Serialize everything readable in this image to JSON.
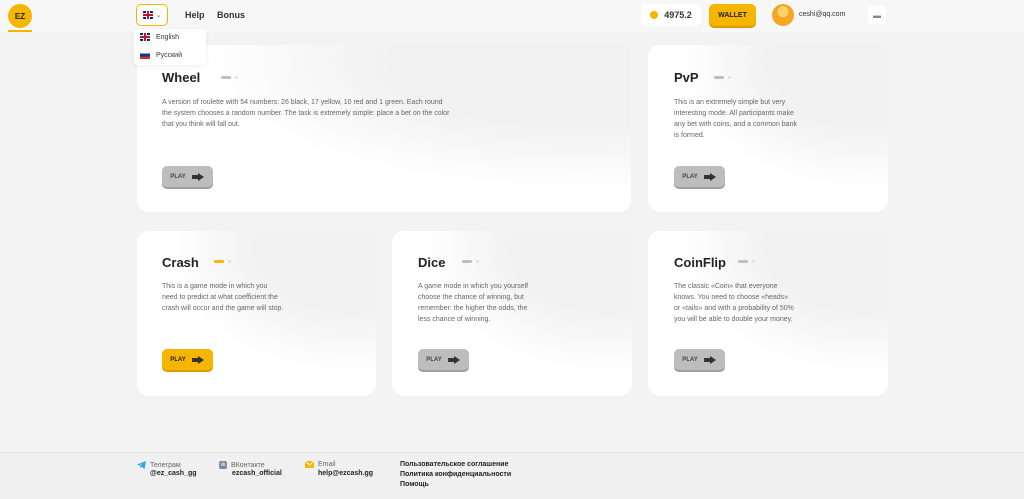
{
  "header": {
    "logo_text": "EZ",
    "nav": [
      {
        "label": "Help"
      },
      {
        "label": "Bonus"
      }
    ],
    "balance": "4975.2",
    "wallet_label": "WALLET",
    "user_email": "ceshi@qq.com"
  },
  "language_menu": {
    "options": [
      {
        "label": "English",
        "flag": "uk-flag"
      },
      {
        "label": "Русский",
        "flag": "ru-flag"
      }
    ]
  },
  "games": [
    {
      "title": "Wheel",
      "description": "A version of roulette with 54 numbers: 26 black, 17 yellow, 10 red and 1 green. Each round the system chooses a random number. The task is extremely simple: place a bet on the color that you think will fall out.",
      "play_label": "PLAY",
      "active": false
    },
    {
      "title": "PvP",
      "description": "This is an extremely simple but very interesting mode. All participants make any bet with coins, and a common bank is formed.",
      "play_label": "PLAY",
      "active": false
    },
    {
      "title": "Crash",
      "description": "This is a game mode in which you need to predict at what coefficient the crash will occur and the game will stop.",
      "play_label": "PLAY",
      "active": true
    },
    {
      "title": "Dice",
      "description": "A game mode in which you yourself choose the chance of winning, but remember: the higher the odds, the less chance of winning.",
      "play_label": "PLAY",
      "active": false
    },
    {
      "title": "CoinFlip",
      "description": "The classic «Coin» that everyone knows. You need to choose «heads» or «tails» and with a probability of 50% you will be able to double your money.",
      "play_label": "PLAY",
      "active": false
    }
  ],
  "footer": {
    "telegram": {
      "label": "Телеграм",
      "value": "@ez_cash_gg"
    },
    "vk": {
      "label": "ВКонтакте",
      "value": "ezcash_official"
    },
    "email": {
      "label": "Email",
      "value": "help@ezcash.gg"
    },
    "links": [
      "Пользовательское соглашение",
      "Политика конфиденциальности",
      "Помощь"
    ]
  },
  "colors": {
    "accent": "#f5b500",
    "button_inactive": "#bdbdbd"
  }
}
